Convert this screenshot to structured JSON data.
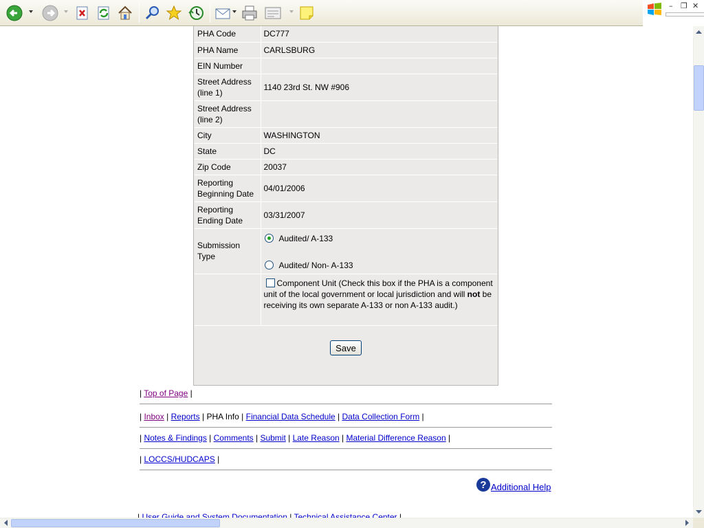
{
  "form": {
    "rows": [
      {
        "label": "PHA Code",
        "value": "DC777"
      },
      {
        "label": "PHA Name",
        "value": "CARLSBURG"
      },
      {
        "label": "EIN Number",
        "value": ""
      },
      {
        "label": "Street Address (line 1)",
        "value": "1140 23rd St. NW #906"
      },
      {
        "label": "Street Address (line 2)",
        "value": ""
      },
      {
        "label": "City",
        "value": "WASHINGTON"
      },
      {
        "label": "State",
        "value": "DC"
      },
      {
        "label": "Zip Code",
        "value": "20037"
      },
      {
        "label": "Reporting Beginning Date",
        "value": "04/01/2006"
      },
      {
        "label": "Reporting Ending Date",
        "value": "03/31/2007"
      }
    ],
    "submission_type_label": "Submission Type",
    "option_audited": "Audited/ A-133",
    "option_non_audited": "Audited/ Non- A-133",
    "component_unit_pre": "Component Unit (Check this box if the PHA is a component unit of the local government or local jurisdiction and will ",
    "component_unit_bold": "not",
    "component_unit_post": " be receiving its own separate A-133 or non A-133 audit.)",
    "save_label": "Save"
  },
  "footer": {
    "top_of_page": "Top of Page",
    "inbox": "Inbox",
    "reports": "Reports",
    "pha_info": "PHA Info",
    "financial_data_schedule": "Financial Data Schedule",
    "data_collection_form": "Data Collection Form",
    "notes_findings": "Notes & Findings",
    "comments": "Comments",
    "submit": "Submit",
    "late_reason": "Late Reason",
    "material_difference_reason": "Material Difference Reason",
    "loccs_hudcaps": "LOCCS/HUDCAPS",
    "additional_help": "Additional Help",
    "user_guide": "User Guide and System Documentation",
    "technical_assistance": "Technical Assistance Center"
  }
}
